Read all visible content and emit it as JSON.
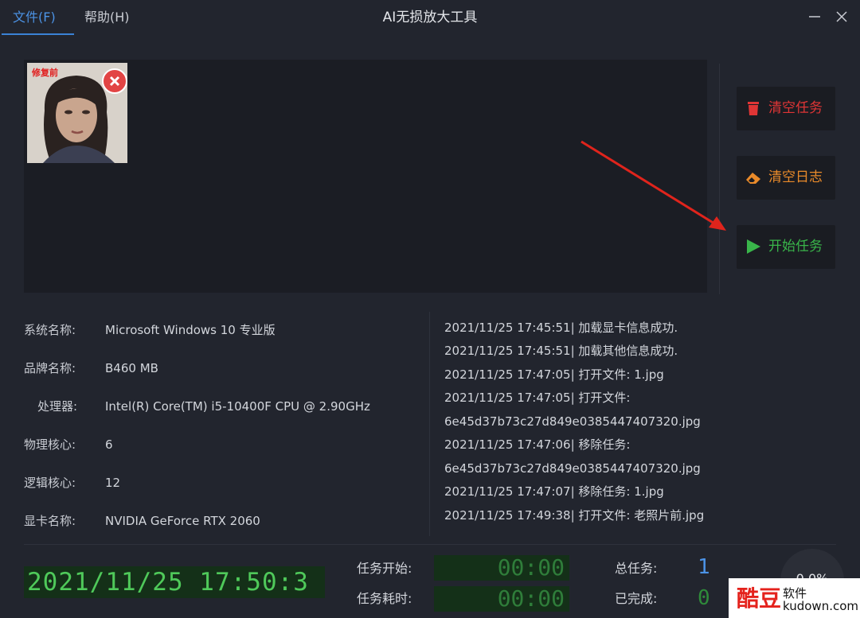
{
  "menu": {
    "file": "文件(F)",
    "help": "帮助(H)"
  },
  "app_title": "AI无损放大工具",
  "preview": {
    "thumb_label": "修复前"
  },
  "actions": {
    "clear_tasks": "清空任务",
    "clear_log": "清空日志",
    "start_task": "开始任务"
  },
  "system_info": [
    {
      "key": "系统名称:",
      "value": "Microsoft Windows 10 专业版"
    },
    {
      "key": "品牌名称:",
      "value": "B460 MB"
    },
    {
      "key": "处理器:",
      "value": "Intel(R) Core(TM) i5-10400F CPU @ 2.90GHz"
    },
    {
      "key": "物理核心:",
      "value": "6"
    },
    {
      "key": "逻辑核心:",
      "value": "12"
    },
    {
      "key": "显卡名称:",
      "value": "NVIDIA GeForce RTX 2060"
    }
  ],
  "log": [
    "2021/11/25 17:45:51| 加载显卡信息成功.",
    "2021/11/25 17:45:51| 加载其他信息成功.",
    "2021/11/25 17:47:05| 打开文件: 1.jpg",
    "2021/11/25 17:47:05| 打开文件:",
    "6e45d37b73c27d849e0385447407320.jpg",
    "2021/11/25 17:47:06| 移除任务:",
    "6e45d37b73c27d849e0385447407320.jpg",
    "2021/11/25 17:47:07| 移除任务: 1.jpg",
    "2021/11/25 17:49:38| 打开文件: 老照片前.jpg"
  ],
  "status": {
    "clock": "2021/11/25 17:50:3",
    "task_start_label": "任务开始:",
    "task_start_value": "00:00",
    "task_elapsed_label": "任务耗时:",
    "task_elapsed_value": "00:00",
    "total_label": "总任务:",
    "total_value": "1",
    "done_label": "已完成:",
    "done_value": "0",
    "progress": "0.0%"
  },
  "watermark": {
    "logo": "酷豆",
    "top": "软件",
    "bottom": "kudown.com"
  },
  "colors": {
    "accent": "#3b82d6",
    "danger": "#e03535",
    "warning": "#e98a2a",
    "success": "#39b54a",
    "lcd": "#4fc95a"
  }
}
